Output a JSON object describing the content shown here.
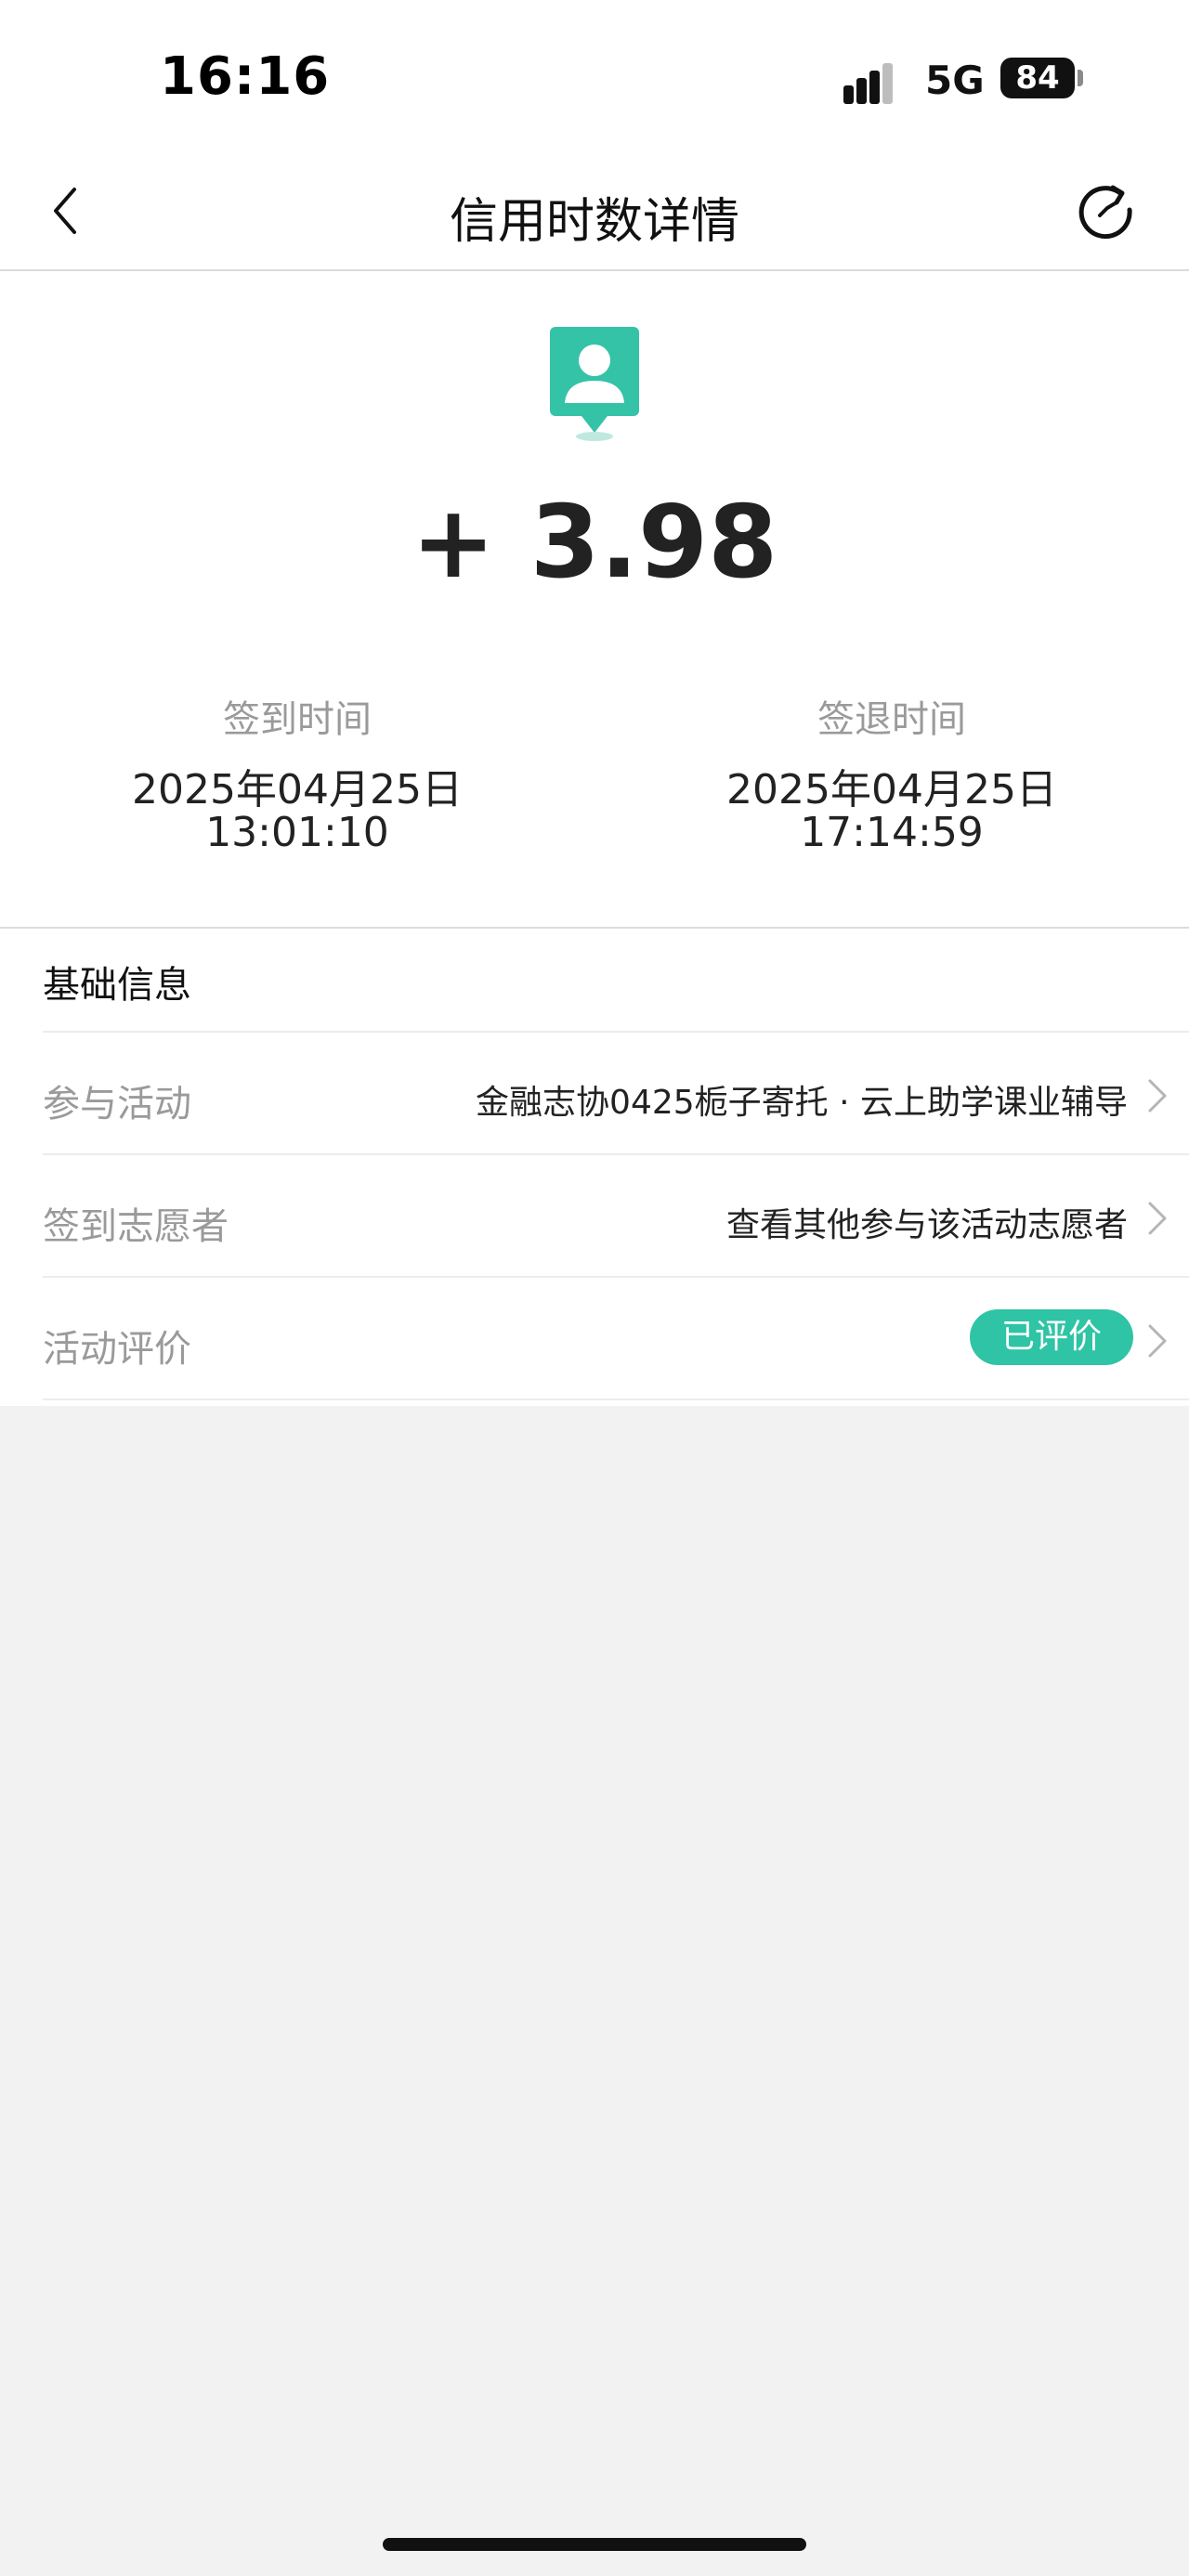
{
  "status_bar": {
    "time": "16:16",
    "network": "5G",
    "battery": "84"
  },
  "nav": {
    "title": "信用时数详情",
    "back_icon": "chevron-left-icon",
    "share_icon": "share-refresh-icon"
  },
  "summary": {
    "icon": "volunteer-badge-icon",
    "points": "+ 3.98",
    "checkin": {
      "label": "签到时间",
      "date": "2025年04月25日",
      "time": "13:01:10"
    },
    "checkout": {
      "label": "签退时间",
      "date": "2025年04月25日",
      "time": "17:14:59"
    }
  },
  "info": {
    "section_title": "基础信息",
    "rows": [
      {
        "label": "参与活动",
        "value": "金融志协0425栀子寄托 · 云上助学课业辅导"
      },
      {
        "label": "签到志愿者",
        "value": "查看其他参与该活动志愿者"
      },
      {
        "label": "活动评价",
        "value": "已评价"
      }
    ]
  },
  "colors": {
    "accent": "#2ec4a5",
    "background": "#f2f2f2"
  }
}
